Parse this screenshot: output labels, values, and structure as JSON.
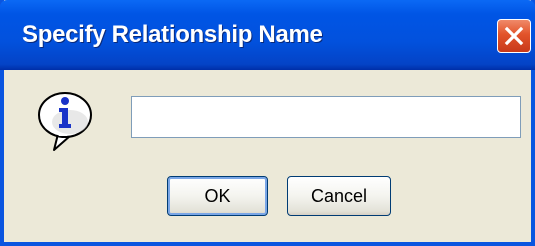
{
  "dialog": {
    "title": "Specify Relationship Name",
    "message_icon": "info-icon",
    "name_field": {
      "value": "",
      "placeholder": ""
    },
    "buttons": {
      "ok_label": "OK",
      "cancel_label": "Cancel"
    },
    "close_icon": "close-icon"
  },
  "colors": {
    "titlebar": "#0251dd",
    "dialog_background": "#ece9d8",
    "close_button": "#e2532a",
    "info_icon_letter": "#1a33c8"
  }
}
